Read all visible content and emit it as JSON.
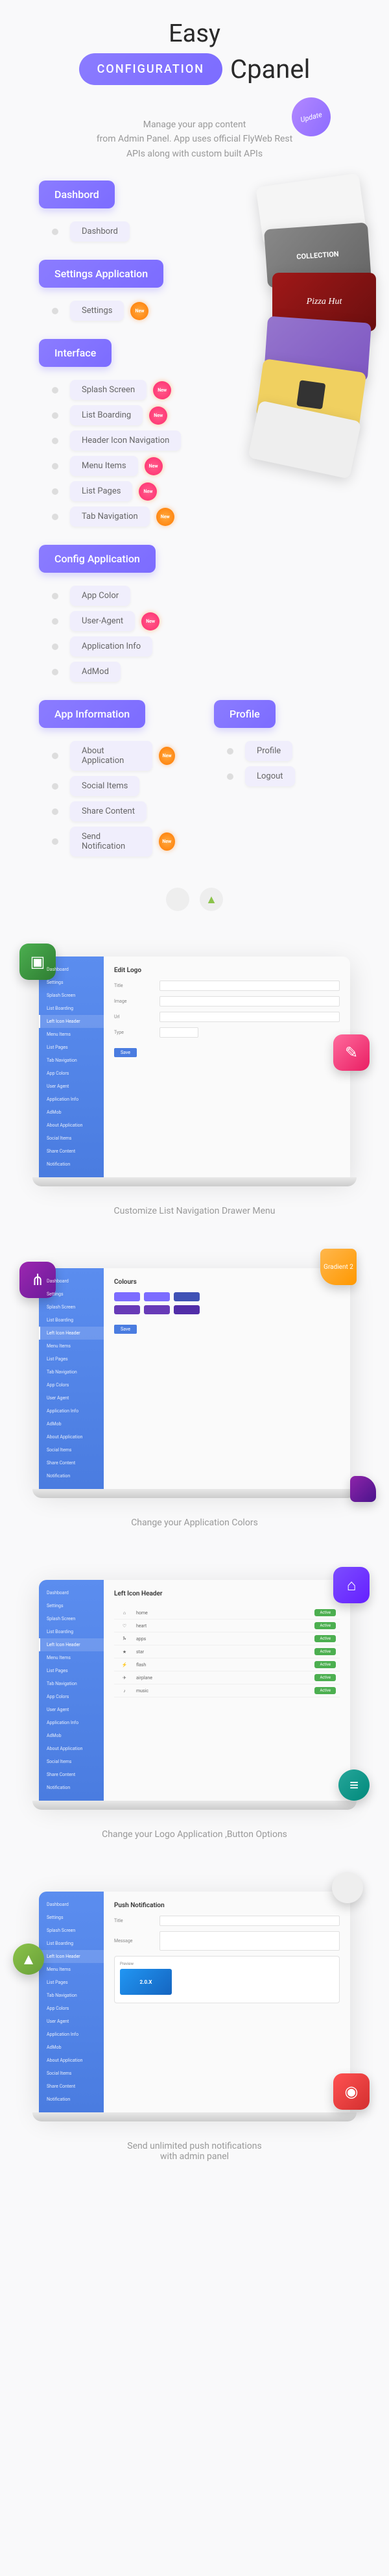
{
  "header": {
    "easy": "Easy",
    "configuration": "CONFIGURATION",
    "cpanel": "Cpanel",
    "update_badge": "Update"
  },
  "tagline": "Manage your app content\nfrom Admin Panel. App uses official FlyWeb Rest\nAPIs along with custom built APIs",
  "sections": {
    "dashboard": {
      "title": "Dashbord",
      "items": [
        "Dashbord"
      ]
    },
    "settings": {
      "title": "Settings Application",
      "items": [
        "Settings"
      ]
    },
    "interface": {
      "title": "Interface",
      "items": [
        "Splash Screen",
        "List Boarding",
        "Header Icon Navigation",
        "Menu Items",
        "List Pages",
        "Tab Navigation"
      ]
    },
    "config": {
      "title": "Config Application",
      "items": [
        "App Color",
        "User-Agent",
        "Application Info",
        "AdMod"
      ]
    },
    "appinfo": {
      "title": "App Information",
      "items": [
        "About Application",
        "Social Items",
        "Share Content",
        "Send Notification"
      ]
    },
    "profile": {
      "title": "Profile",
      "items": [
        "Profile",
        "Logout"
      ]
    }
  },
  "phone_previews": {
    "collection_label": "COLLECTION",
    "pizza_label": "Pizza Hut"
  },
  "laptops": [
    {
      "caption": "Customize List Navigation Drawer Menu",
      "panel_title": "Edit Logo",
      "sidebar": [
        "Dashboard",
        "Settings",
        "Splash Screen",
        "List Boarding",
        "Left Icon Header",
        "Menu Items",
        "List Pages",
        "Tab Navigation",
        "App Colors",
        "User Agent",
        "Application Info",
        "AdMob",
        "About Application",
        "Social Items",
        "Share Content",
        "Notification"
      ]
    },
    {
      "caption": "Change your Application Colors",
      "panel_title": "Colours",
      "gradient_label": "Gradient 2",
      "color_rows": [
        [
          "#7c6cff",
          "#7c6cff",
          "#3f51b5"
        ],
        [
          "#673ab7",
          "#673ab7",
          "#512da8"
        ]
      ]
    },
    {
      "caption": "Change your Logo Application ,Button Options",
      "panel_title": "Left Icon Header",
      "toggle_rows": [
        {
          "icon": "⌂",
          "label": "home",
          "status": "Active"
        },
        {
          "icon": "♡",
          "label": "heart",
          "status": "Active"
        },
        {
          "icon": "Ⰳ",
          "label": "apps",
          "status": "Active"
        },
        {
          "icon": "★",
          "label": "star",
          "status": "Active"
        },
        {
          "icon": "⚡",
          "label": "flash",
          "status": "Active"
        },
        {
          "icon": "✈",
          "label": "airplane",
          "status": "Active"
        },
        {
          "icon": "♪",
          "label": "music",
          "status": "Active"
        }
      ]
    },
    {
      "caption": "Send unlimited push notifications\nwith admin panel",
      "panel_title": "Push Notification",
      "notif_preview": "2.0.X"
    }
  ]
}
